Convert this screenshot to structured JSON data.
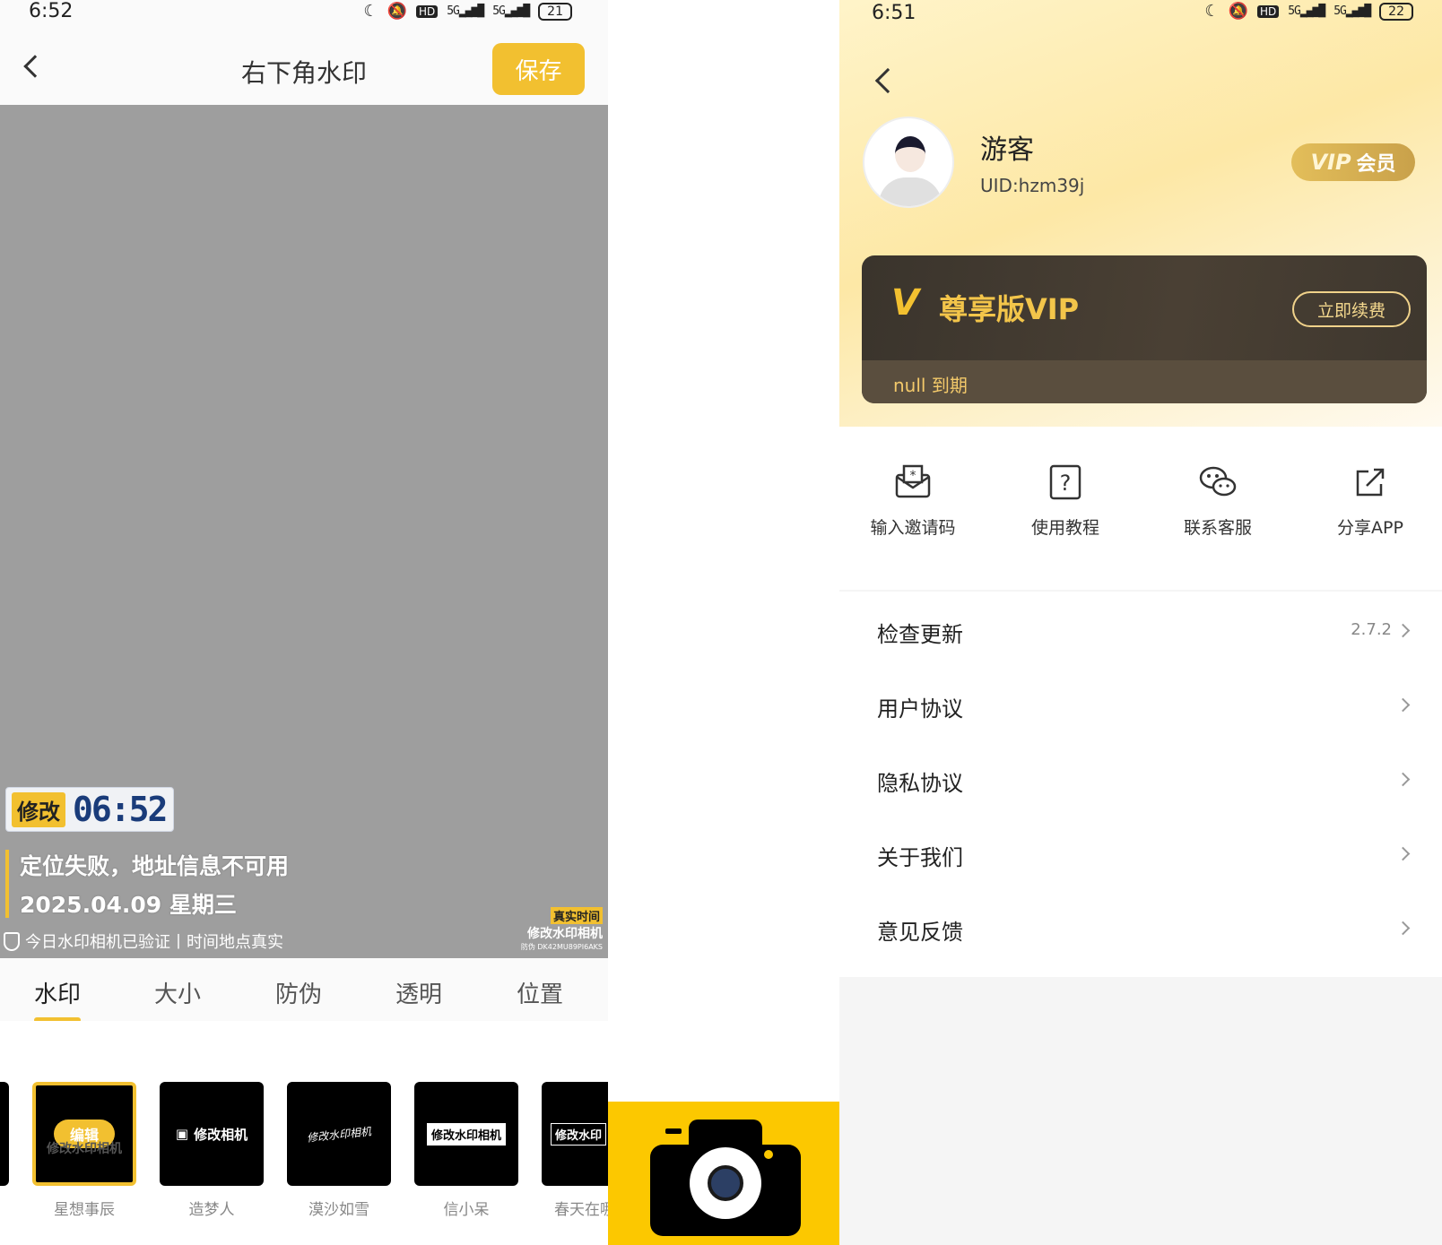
{
  "left": {
    "status": {
      "time": "6:52",
      "hd": "HD",
      "signal1": "5G",
      "signal2": "5G",
      "battery": "21"
    },
    "header": {
      "title": "右下角水印",
      "save_label": "保存"
    },
    "watermark": {
      "tag": "修改",
      "time": "06:52",
      "location": "定位失败，地址信息不可用",
      "date": "2025.04.09 星期三",
      "verify": "今日水印相机已验证丨时间地点真实",
      "real_time_tag": "真实时间",
      "brand": "修改水印相机",
      "code": "防伪 DK42MU89PI6AKS"
    },
    "tabs": [
      {
        "label": "水印"
      },
      {
        "label": "大小"
      },
      {
        "label": "防伪"
      },
      {
        "label": "透明"
      },
      {
        "label": "位置"
      }
    ],
    "styles": [
      {
        "thumb": "修改水印相机",
        "edit": "编辑",
        "label": "星想事辰"
      },
      {
        "thumb": "修改相机",
        "label": "造梦人"
      },
      {
        "thumb": "修改水印相机",
        "label": "漠沙如雪"
      },
      {
        "thumb": "修改水印相机",
        "label": "信小呆"
      },
      {
        "thumb": "修改水印",
        "label": "春天在哪"
      }
    ]
  },
  "logo": {
    "name": "camera-app-logo",
    "color": "#fcc800"
  },
  "right": {
    "status": {
      "time": "6:51",
      "hd": "HD",
      "signal1": "5G",
      "signal2": "5G",
      "battery": "22"
    },
    "profile": {
      "name": "游客",
      "uid": "UID:hzm39j",
      "vip_badge_logo": "VIP",
      "vip_badge_text": "会员"
    },
    "vip_card": {
      "logo": "V",
      "title": "尊享版VIP",
      "renew_label": "立即续费",
      "expire": "null 到期"
    },
    "quick_actions": [
      {
        "label": "输入邀请码",
        "icon": "invite-envelope-icon"
      },
      {
        "label": "使用教程",
        "icon": "help-question-icon"
      },
      {
        "label": "联系客服",
        "icon": "wechat-icon"
      },
      {
        "label": "分享APP",
        "icon": "share-icon"
      }
    ],
    "menu": [
      {
        "label": "检查更新",
        "value": "2.7.2"
      },
      {
        "label": "用户协议",
        "value": ""
      },
      {
        "label": "隐私协议",
        "value": ""
      },
      {
        "label": "关于我们",
        "value": ""
      },
      {
        "label": "意见反馈",
        "value": ""
      }
    ]
  }
}
